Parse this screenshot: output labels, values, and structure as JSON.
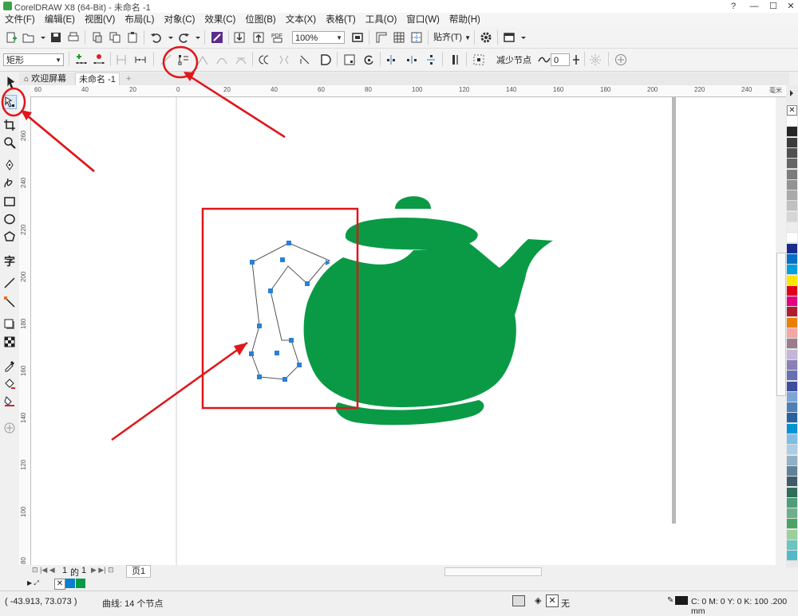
{
  "window": {
    "title": "CorelDRAW X8 (64-Bit) - 未命名 -1",
    "controls": [
      "?",
      "—",
      "☐",
      "✕"
    ]
  },
  "menu": [
    "文件(F)",
    "编辑(E)",
    "视图(V)",
    "布局(L)",
    "对象(C)",
    "效果(C)",
    "位图(B)",
    "文本(X)",
    "表格(T)",
    "工具(O)",
    "窗口(W)",
    "帮助(H)"
  ],
  "toolbar": {
    "zoom": "100%",
    "snap_label": "贴齐(T)"
  },
  "property_bar": {
    "shape_select": "矩形",
    "reduce_nodes_label": "减少节点",
    "smoothness": "0"
  },
  "tabs": {
    "welcome": "欢迎屏幕",
    "document": "未命名 -1",
    "add": "+"
  },
  "ruler": {
    "h_labels": [
      "60",
      "40",
      "20",
      "0",
      "20",
      "40",
      "60",
      "80",
      "100",
      "120",
      "140",
      "160",
      "180",
      "200",
      "220",
      "240"
    ],
    "h_units": "毫米",
    "v_labels": [
      "260",
      "240",
      "220",
      "200",
      "180",
      "160",
      "140",
      "120",
      "100",
      "80"
    ]
  },
  "page_nav": {
    "current": "1",
    "of_label": "的",
    "total": "1",
    "page_tab": "页1"
  },
  "status": {
    "coords": "( -43.913, 73.073 )",
    "selection": "曲线: 14 个节点",
    "fill_none": "无",
    "outline": "C: 0 M: 0 Y: 0 K: 100  .200 mm"
  },
  "colors": {
    "teapot": "#0a9a46",
    "node": "#2a7fd8",
    "annotation": "#e0161a",
    "palette": [
      "#ffffff",
      "#262626",
      "#3b3b3b",
      "#505050",
      "#666666",
      "#7c7c7c",
      "#939393",
      "#a9a9a9",
      "#c0c0c0",
      "#d6d6d6",
      "#ededed",
      "#ffffff",
      "#1a2b8c",
      "#0070c8",
      "#00a0e0",
      "#ffe400",
      "#e10018",
      "#e4007f",
      "#b01c2e",
      "#e98000",
      "#f4a7a1",
      "#9a7c8a",
      "#c3b6d6",
      "#8a7fb6",
      "#6670b5",
      "#3e4d9c",
      "#7da5d6",
      "#4f7fb7",
      "#2a62a0",
      "#0094d4",
      "#7fbde2",
      "#a9cfe6",
      "#90b0c8",
      "#5f8296",
      "#3f5b6a",
      "#2d6e5c",
      "#4e9d7a",
      "#6bb08a",
      "#4aa565",
      "#9dcf9a",
      "#6cc4be",
      "#52b9c9"
    ],
    "doc_palette": [
      "#0a7fd0",
      "#0a9a46"
    ]
  },
  "icons": [
    "pick-tool-icon",
    "shape-tool-icon",
    "crop-icon",
    "zoom-icon",
    "freehand-icon",
    "bezier-icon",
    "rectangle-icon",
    "ellipse-icon",
    "polygon-icon",
    "text-icon",
    "parallel-dimension-icon",
    "connector-icon",
    "drop-shadow-icon",
    "transparency-icon",
    "eyedropper-icon",
    "interactive-fill-icon",
    "smart-fill-icon",
    "add-icon"
  ]
}
